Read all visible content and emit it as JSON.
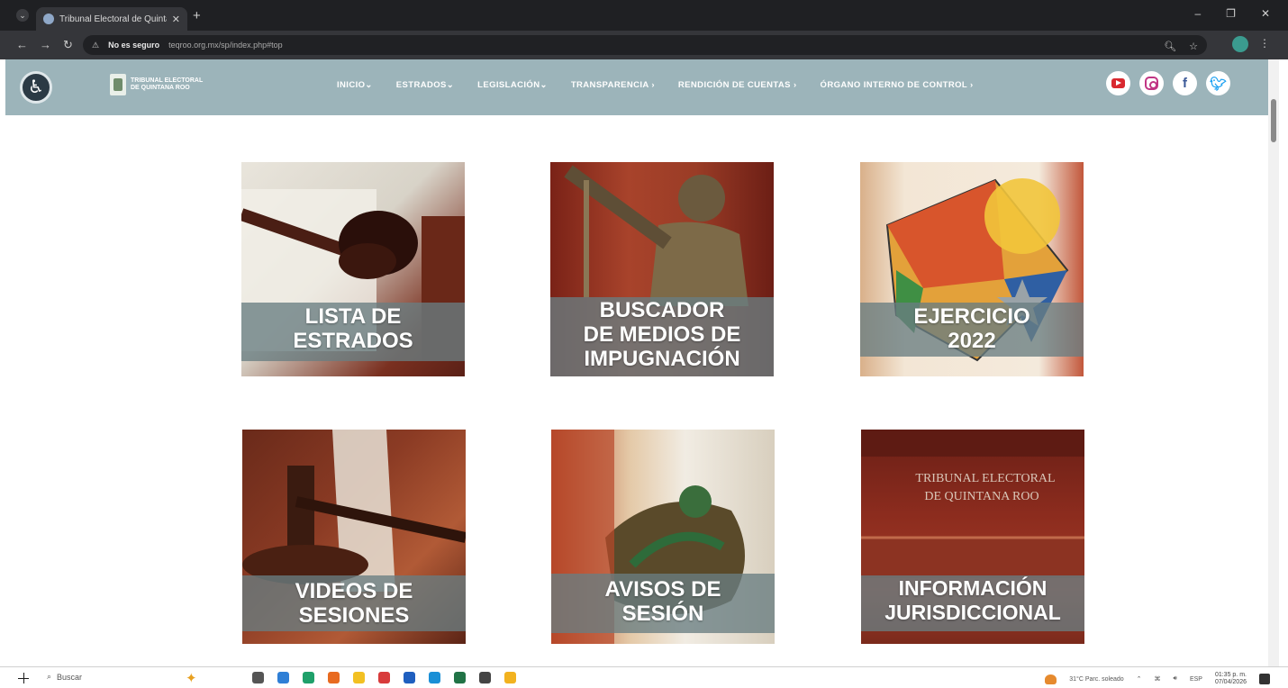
{
  "browser": {
    "tab_title": "Tribunal Electoral de Quintana Roo",
    "security_label": "No es seguro",
    "url": "teqroo.org.mx/sp/index.php#top"
  },
  "site": {
    "logo_line1": "TRIBUNAL ELECTORAL",
    "logo_line2": "DE QUINTANA ROO",
    "nav": [
      {
        "label": "INICIO⌄"
      },
      {
        "label": "ESTRADOS⌄"
      },
      {
        "label": "LEGISLACIÓN⌄"
      },
      {
        "label": "TRANSPARENCIA ›"
      },
      {
        "label": "RENDICIÓN DE CUENTAS ›"
      },
      {
        "label": "ÓRGANO INTERNO DE CONTROL ›"
      }
    ],
    "social": [
      {
        "icon": "youtube-icon",
        "color": "#d9282f"
      },
      {
        "icon": "instagram-icon",
        "color": "#c13584"
      },
      {
        "icon": "facebook-icon",
        "color": "#3b5998"
      },
      {
        "icon": "twitter-icon",
        "color": "#1da1f2"
      }
    ],
    "header_color": "#9cb4ba"
  },
  "tiles": [
    {
      "line1": "LISTA DE",
      "line2": "ESTRADOS",
      "line3": ""
    },
    {
      "line1": "BUSCADOR",
      "line2": "DE MEDIOS DE",
      "line3": "IMPUGNACIÓN"
    },
    {
      "line1": "EJERCICIO",
      "line2": "2022",
      "line3": ""
    },
    {
      "line1": "VIDEOS DE",
      "line2": "SESIONES",
      "line3": ""
    },
    {
      "line1": "AVISOS DE",
      "line2": "SESIÓN",
      "line3": ""
    },
    {
      "line1": "INFORMACIÓN",
      "line2": "JURISDICCIONAL",
      "line3": ""
    }
  ],
  "building_sign": {
    "line1": "TRIBUNAL ELECTORAL",
    "line2": "DE QUINTANA ROO"
  },
  "taskbar": {
    "search_label": "Buscar",
    "weather": "31°C Parc. soleado",
    "lang": "ESP",
    "time": "01:35 p. m.",
    "date": "07/04/2026"
  }
}
